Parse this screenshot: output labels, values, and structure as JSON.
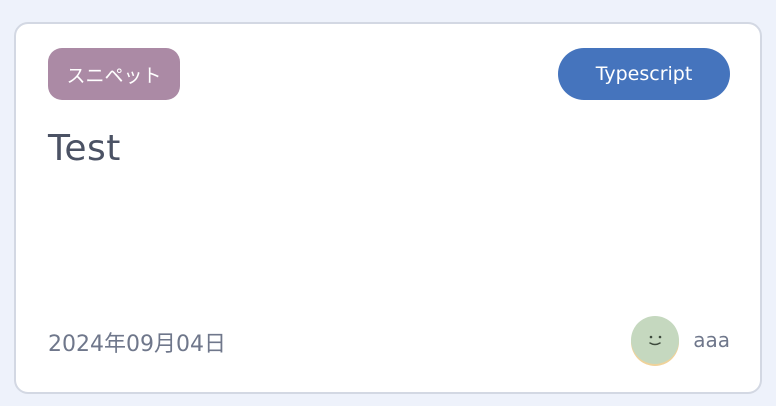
{
  "card": {
    "category": "スニペット",
    "language": "Typescript",
    "title": "Test",
    "date": "2024年09月04日",
    "author": {
      "name": "aaa",
      "avatar_icon": "smiley-face-avatar"
    }
  },
  "colors": {
    "category_badge": "#ab8aa5",
    "language_badge": "#4574bd",
    "title_text": "#4b5264",
    "meta_text": "#6f778b",
    "avatar_bg": "#c5d8bf"
  }
}
